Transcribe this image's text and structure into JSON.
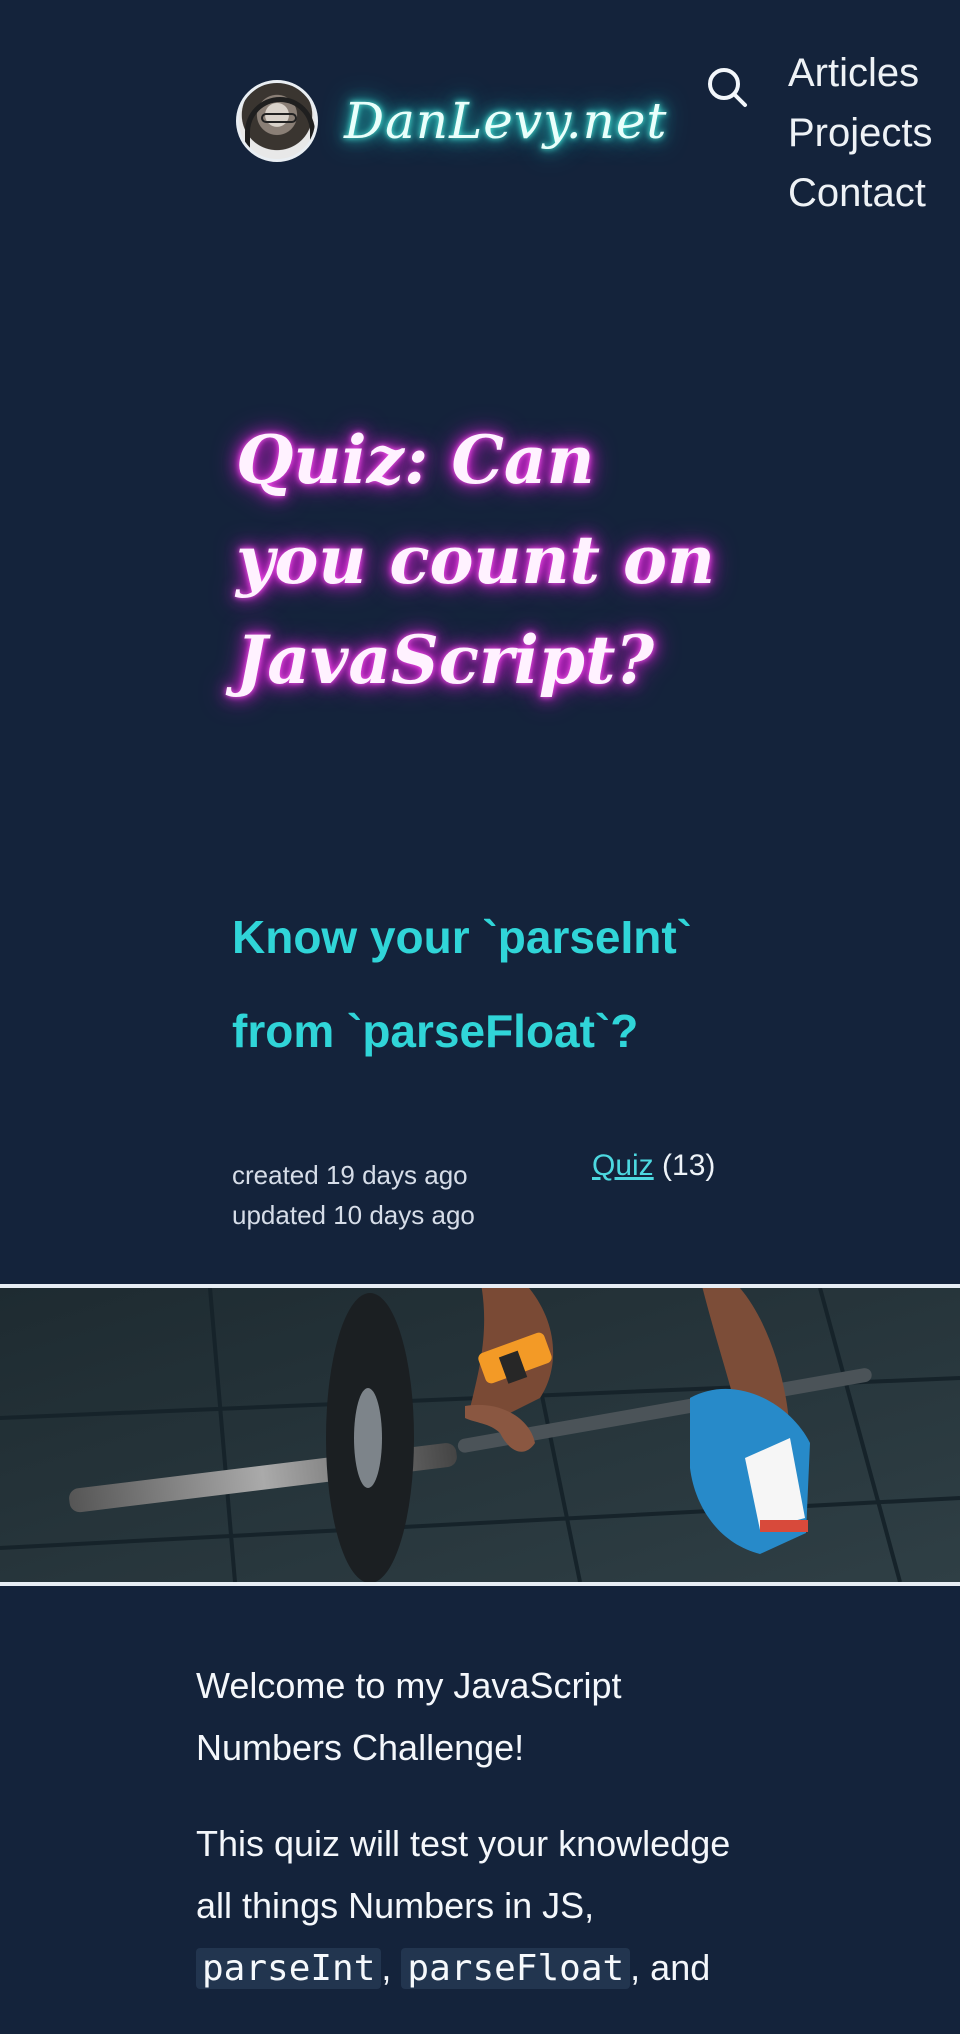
{
  "header": {
    "site_name": "DanLevy.net",
    "avatar": "author-avatar",
    "search_icon": "search-icon",
    "nav": [
      "Articles",
      "Projects",
      "Contact"
    ]
  },
  "article": {
    "title_lines": [
      "Quiz: Can",
      "you count on",
      "JavaScript?"
    ],
    "subtitle_lines": [
      "Know your `parseInt`",
      "from `parseFloat`?"
    ],
    "created": "created 19 days ago",
    "updated": "updated 10 days ago",
    "tag": "Quiz",
    "tag_count": "(13)"
  },
  "content": {
    "intro_lines": [
      "Welcome to my JavaScript",
      "Numbers Challenge!"
    ],
    "second_lines": [
      "This quiz will test your knowledge",
      "all things Numbers in JS,"
    ],
    "code_1": "parseInt",
    "code_2": "parseFloat",
    "sep_1": ",",
    "sep_2": ", and"
  },
  "colors": {
    "page_bg": "#14233b",
    "site_name_glow": "#27d8d1",
    "title_glow": "#e624df",
    "subtitle": "#30d5d8"
  }
}
